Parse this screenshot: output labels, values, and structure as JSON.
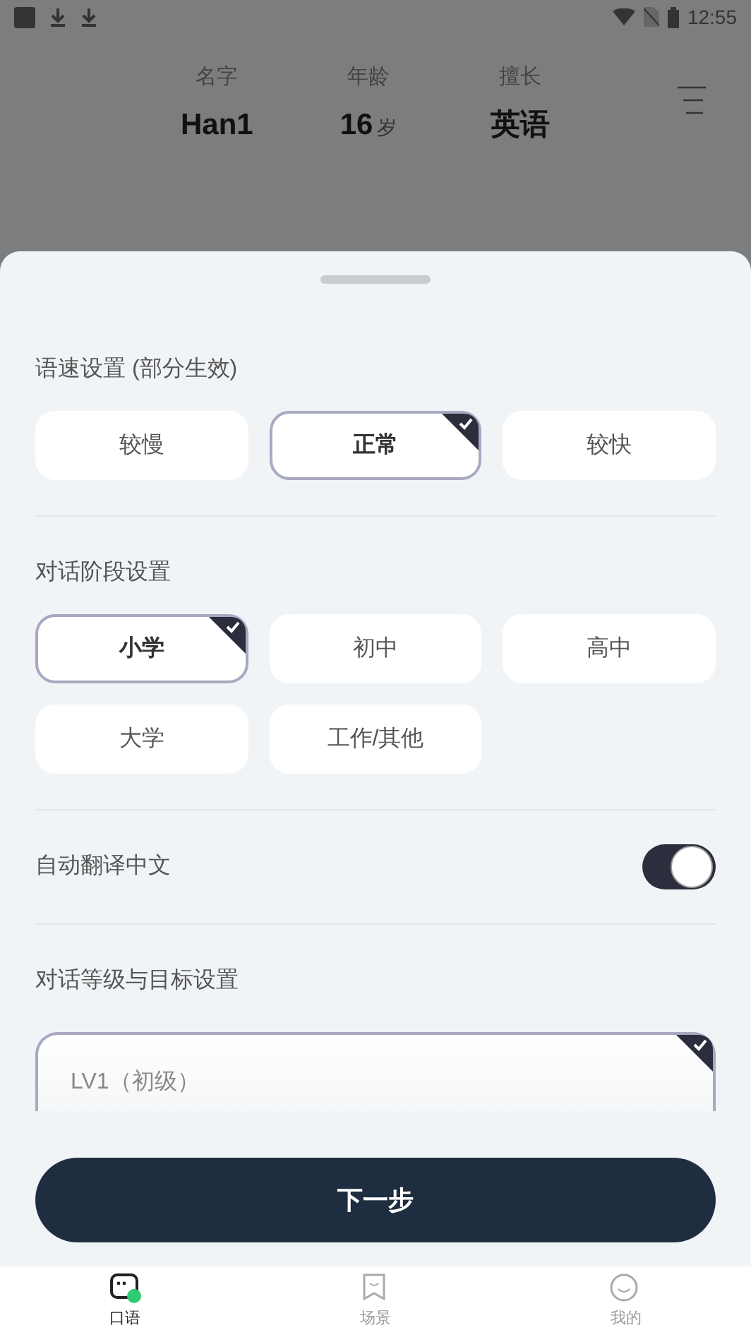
{
  "status_bar": {
    "time": "12:55"
  },
  "profile": [
    {
      "label": "名字",
      "value": "Han1"
    },
    {
      "label": "年龄",
      "value": "16",
      "unit": "岁"
    },
    {
      "label": "擅长",
      "value": "英语"
    }
  ],
  "speed": {
    "title": "语速设置 (部分生效)",
    "options": [
      {
        "label": "较慢",
        "selected": false
      },
      {
        "label": "正常",
        "selected": true
      },
      {
        "label": "较快",
        "selected": false
      }
    ]
  },
  "stage": {
    "title": "对话阶段设置",
    "options": [
      {
        "label": "小学",
        "selected": true
      },
      {
        "label": "初中",
        "selected": false
      },
      {
        "label": "高中",
        "selected": false
      },
      {
        "label": "大学",
        "selected": false
      },
      {
        "label": "工作/其他",
        "selected": false
      }
    ]
  },
  "auto_translate": {
    "label": "自动翻译中文",
    "on": true
  },
  "level": {
    "title": "对话等级与目标设置",
    "options": [
      {
        "label": "LV1（初级）",
        "selected": true
      }
    ]
  },
  "next_button": "下一步",
  "nav": [
    {
      "label": "口语",
      "selected": true
    },
    {
      "label": "场景",
      "selected": false
    },
    {
      "label": "我的",
      "selected": false
    }
  ]
}
